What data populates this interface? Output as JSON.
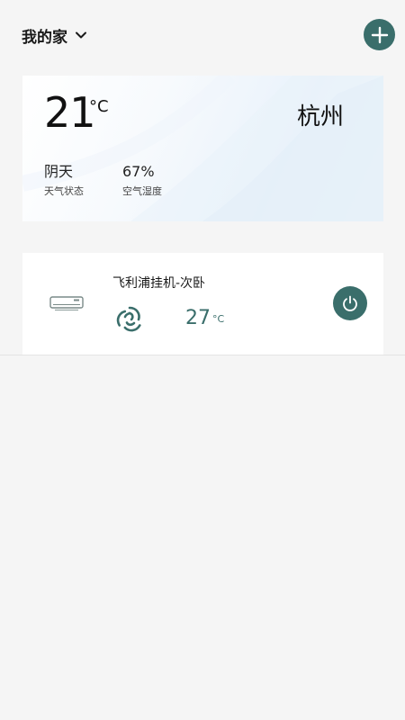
{
  "header": {
    "home_title": "我的家"
  },
  "weather": {
    "temperature": "21",
    "unit": "°C",
    "city": "杭州",
    "condition": "阴天",
    "condition_label": "天气状态",
    "humidity": "67%",
    "humidity_label": "空气湿度"
  },
  "device": {
    "name": "飞利浦挂机-次卧",
    "set_temperature": "27",
    "unit": "°C",
    "icons": {
      "device": "air-conditioner-icon",
      "mode": "fan-mode-icon",
      "power": "power-icon"
    }
  },
  "colors": {
    "accent": "#3a6e6b",
    "background": "#f5f5f5",
    "card": "#ffffff"
  }
}
